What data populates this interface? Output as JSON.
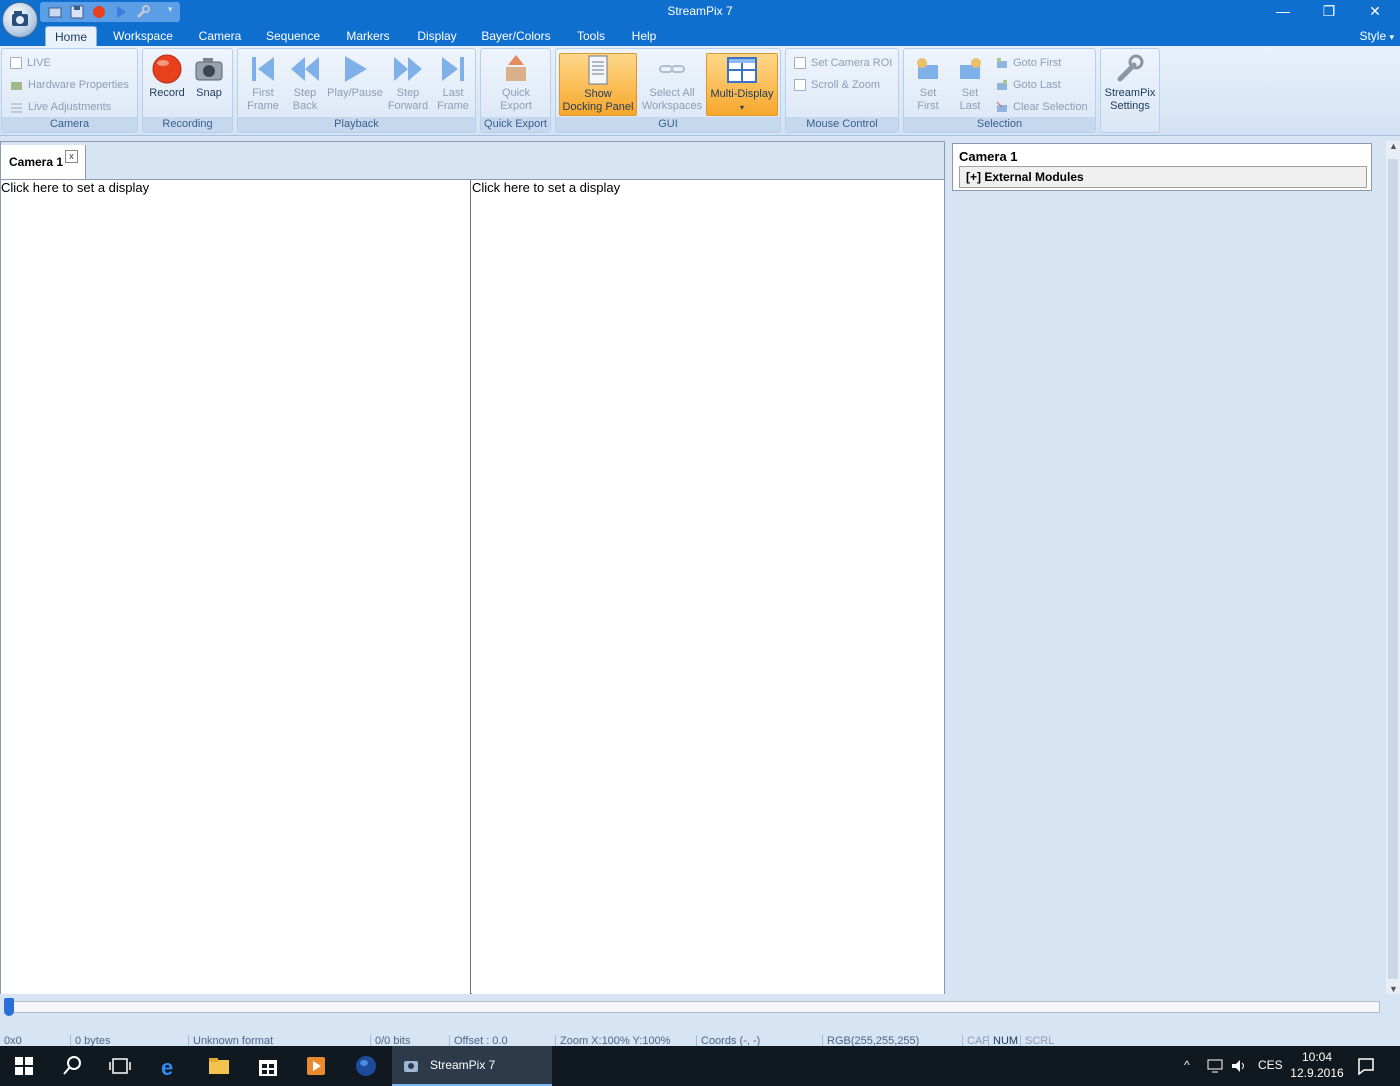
{
  "window": {
    "title": "StreamPix 7",
    "minimize": "—",
    "restore": "❐",
    "close": "✕"
  },
  "ribbon_tabs": [
    "Home",
    "Workspace",
    "Camera",
    "Sequence",
    "Markers",
    "Display",
    "Bayer/Colors",
    "Tools",
    "Help"
  ],
  "style_menu": "Style",
  "groups": {
    "camera": {
      "label": "Camera",
      "live": "LIVE",
      "hardware": "Hardware Properties",
      "live_adj": "Live Adjustments"
    },
    "recording": {
      "label": "Recording",
      "record": "Record",
      "snap": "Snap"
    },
    "playback": {
      "label": "Playback",
      "first1": "First",
      "first2": "Frame",
      "stepback1": "Step",
      "stepback2": "Back",
      "play": "Play/Pause",
      "stepfwd1": "Step",
      "stepfwd2": "Forward",
      "last1": "Last",
      "last2": "Frame"
    },
    "quick_export": {
      "label": "Quick Export",
      "btn1": "Quick",
      "btn2": "Export"
    },
    "gui": {
      "label": "GUI",
      "show1": "Show",
      "show2": "Docking Panel",
      "sel1": "Select All",
      "sel2": "Workspaces",
      "multi": "Multi-Display"
    },
    "mouse": {
      "label": "Mouse Control",
      "roi": "Set Camera ROI",
      "scroll": "Scroll & Zoom"
    },
    "selection": {
      "label": "Selection",
      "setfirst1": "Set",
      "setfirst2": "First",
      "setlast1": "Set",
      "setlast2": "Last",
      "goto_first": "Goto First",
      "goto_last": "Goto Last",
      "clear": "Clear Selection"
    },
    "settings": {
      "line1": "StreamPix",
      "line2": "Settings"
    }
  },
  "document": {
    "tab_label": "Camera 1",
    "tab_close": "x",
    "pane_left": "Click here to set a display",
    "pane_right": "Click here to set a display"
  },
  "dock": {
    "title": "Camera 1",
    "external_modules": "[+] External Modules"
  },
  "timeline": {
    "position_fraction": 0.0
  },
  "status": {
    "resolution": "0x0",
    "size": "0 bytes",
    "format": "Unknown format",
    "bits": "0/0 bits",
    "offset": "Offset : 0.0",
    "zoom": "Zoom X:100%  Y:100%",
    "coords": "Coords (-, -)",
    "rgb": "RGB(255,255,255)",
    "cap": "CAP",
    "num": "NUM",
    "scrl": "SCRL"
  },
  "taskbar": {
    "app_label": "StreamPix 7",
    "lang": "CES",
    "time": "10:04",
    "date": "12.9.2016"
  },
  "colors": {
    "titlebar": "#0f6fcf",
    "ribbon": "#d6e4f3",
    "hot_button": "#f6a72c",
    "taskbar": "#101820"
  }
}
